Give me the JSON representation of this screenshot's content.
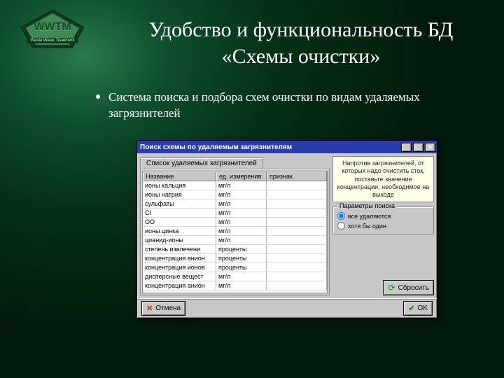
{
  "logo": {
    "text": "WWTM",
    "sub": "Waste Water Treatment"
  },
  "title": "Удобство и функциональность БД «Схемы очистки»",
  "bullet": "Система поиска и подбора схем очистки по видам удаляемых загрязнителей",
  "window": {
    "title": "Поиск схемы по удаляемым загрязнителям",
    "tab": "Список удаляемых загрязнителей",
    "columns": {
      "name": "Название",
      "unit": "ед. измерения",
      "flag": "признак"
    },
    "rows": [
      {
        "name": "ионы кальция",
        "unit": "мг/л",
        "flag": ""
      },
      {
        "name": "ионы натрия",
        "unit": "мг/л",
        "flag": ""
      },
      {
        "name": "сульфаты",
        "unit": "мг/л",
        "flag": ""
      },
      {
        "name": "Cl",
        "unit": "мг/л",
        "flag": ""
      },
      {
        "name": "ОО",
        "unit": "мг/л",
        "flag": ""
      },
      {
        "name": "ионы цинка",
        "unit": "мг/л",
        "flag": ""
      },
      {
        "name": "цианид-ионы",
        "unit": "мг/л",
        "flag": ""
      },
      {
        "name": "степень извлечени",
        "unit": "проценты",
        "flag": ""
      },
      {
        "name": "концентрация анион",
        "unit": "проценты",
        "flag": ""
      },
      {
        "name": "концентрация ионов",
        "unit": "проценты",
        "flag": ""
      },
      {
        "name": "дисперсные вещест",
        "unit": "мг/л",
        "flag": ""
      },
      {
        "name": "концентрация анион",
        "unit": "мг/л",
        "flag": ""
      }
    ],
    "hint": "Напротив загрязнителей, от которых надо очистить сток, поставьте значение концентрации, необходимое на выходе",
    "group": {
      "title": "Параметры поиска",
      "opt1": "все удаляются",
      "opt2": "хотя бы один"
    },
    "reset": "Сбросить",
    "cancel": "Отмена",
    "ok": "OK"
  }
}
